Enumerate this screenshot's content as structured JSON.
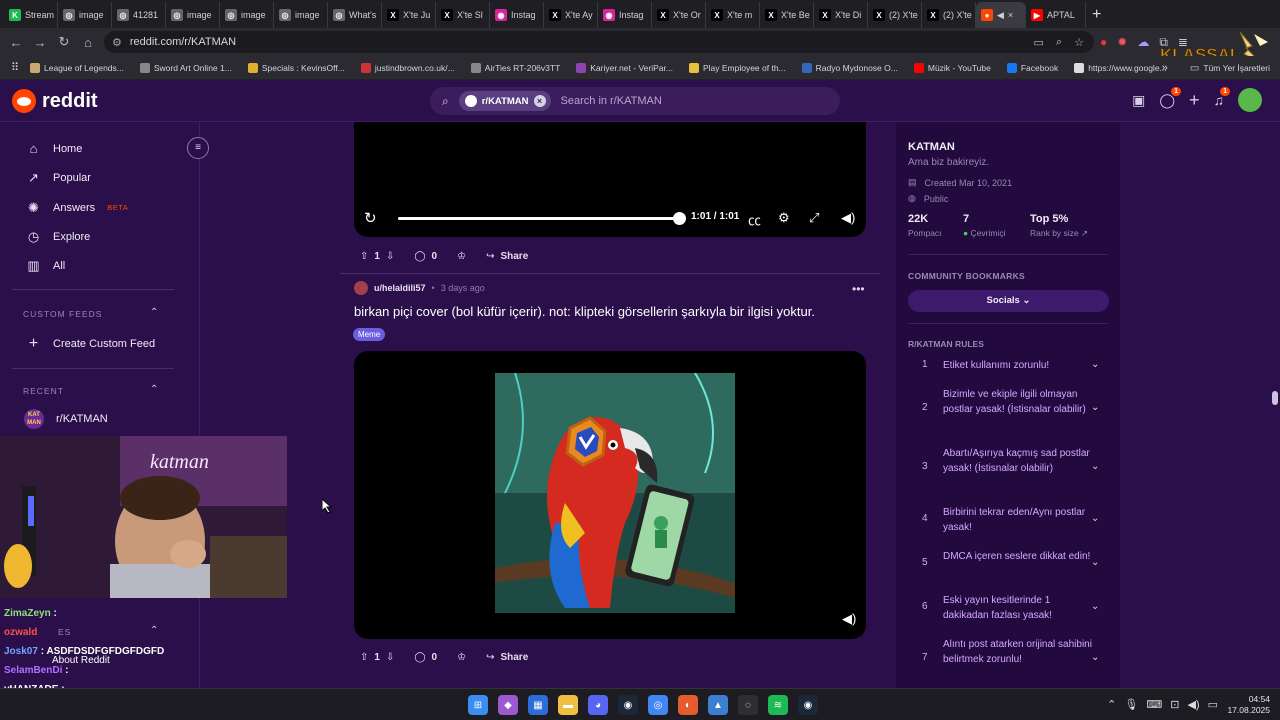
{
  "browser": {
    "tabs": [
      {
        "label": "Stream",
        "color": "#1db954",
        "glyph": "K"
      },
      {
        "label": "image",
        "color": "#666",
        "glyph": "◎"
      },
      {
        "label": "41281",
        "color": "#666",
        "glyph": "◎"
      },
      {
        "label": "image",
        "color": "#666",
        "glyph": "◎"
      },
      {
        "label": "image",
        "color": "#666",
        "glyph": "◎"
      },
      {
        "label": "image",
        "color": "#666",
        "glyph": "◎"
      },
      {
        "label": "What's",
        "color": "#666",
        "glyph": "◎"
      },
      {
        "label": "X'te Ju",
        "color": "#000",
        "glyph": "X"
      },
      {
        "label": "X'te Sl",
        "color": "#000",
        "glyph": "X"
      },
      {
        "label": "Instag",
        "color": "#d6249f",
        "glyph": "◉"
      },
      {
        "label": "X'te Ay",
        "color": "#000",
        "glyph": "X"
      },
      {
        "label": "Instag",
        "color": "#d6249f",
        "glyph": "◉"
      },
      {
        "label": "X'te Or",
        "color": "#000",
        "glyph": "X"
      },
      {
        "label": "X'te m",
        "color": "#000",
        "glyph": "X"
      },
      {
        "label": "X'te Be",
        "color": "#000",
        "glyph": "X"
      },
      {
        "label": "X'te Di",
        "color": "#000",
        "glyph": "X"
      },
      {
        "label": "(2) X'te",
        "color": "#000",
        "glyph": "X"
      },
      {
        "label": "(2) X'te",
        "color": "#000",
        "glyph": "X"
      }
    ],
    "active_tab_glyph": "●",
    "last_tab": {
      "label": "APTAL",
      "color": "#ff0000"
    },
    "url": "reddit.com/r/KATMAN",
    "bookmarks": [
      {
        "label": "League of Legends...",
        "color": "#c8aa6e"
      },
      {
        "label": "Sword Art Online 1...",
        "color": "#888"
      },
      {
        "label": "Specials : KevinsOff...",
        "color": "#e0b030"
      },
      {
        "label": "justindbrown.co.uk/...",
        "color": "#c33"
      },
      {
        "label": "AirTies RT-206v3TT",
        "color": "#888"
      },
      {
        "label": "Kariyer.net - VeriPar...",
        "color": "#8e44ad"
      },
      {
        "label": "Play Employee of th...",
        "color": "#e8c040"
      },
      {
        "label": "Radyo Mydonose O...",
        "color": "#3466c0"
      },
      {
        "label": "Müzik - YouTube",
        "color": "#ff0000"
      },
      {
        "label": "Facebook",
        "color": "#1877f2"
      },
      {
        "label": "https://www.google...",
        "color": "#ddd"
      }
    ],
    "bookmarks_folder": "Tüm Yer İşaretleri"
  },
  "header": {
    "logo": "reddit",
    "search_chip": "r/KATMAN",
    "search_placeholder": "Search in r/KATMAN",
    "chat_badge": "1",
    "notif_badge": "1"
  },
  "sidebar": {
    "items": [
      {
        "label": "Home",
        "icon": "⌂"
      },
      {
        "label": "Popular",
        "icon": "↗"
      },
      {
        "label": "Answers",
        "icon": "✺",
        "tag": "BETA"
      },
      {
        "label": "Explore",
        "icon": "◷"
      },
      {
        "label": "All",
        "icon": "▥"
      }
    ],
    "custom_feeds_title": "CUSTOM FEEDS",
    "create_custom_feed": "Create Custom Feed",
    "recent_title": "RECENT",
    "recent_item": "r/KATMAN",
    "recent_icon_text": "KAT MAN",
    "resources_title": "ES",
    "about": "About Reddit"
  },
  "chat": [
    {
      "user": "ZimaZeyn",
      "msg": ":",
      "color": "#8ee07a"
    },
    {
      "user": "ozwald",
      "msg": "",
      "color": "#ff5050"
    },
    {
      "user": "Josk07",
      "msg": ": ASDFDSDFGFDGFDGFD",
      "color": "#6fa8ff"
    },
    {
      "user": "SelamBenDi",
      "msg": ":",
      "color": "#b070ff"
    },
    {
      "user": "vHANZADE",
      "msg": ":",
      "color": "#ffffff"
    }
  ],
  "feed": {
    "video1": {
      "time": "1:01 / 1:01",
      "progress": 1.0
    },
    "post1_actions": {
      "votes": "1",
      "comments": "0",
      "share": "Share"
    },
    "post2": {
      "user": "u/helaldili57",
      "time": "3 days ago",
      "title": "birkan piçi cover (bol küfür içerir). not: klipteki görsellerin şarkıyla bir ilgisi yoktur.",
      "flair": "Meme",
      "votes": "1",
      "comments": "0",
      "share": "Share"
    }
  },
  "community": {
    "name": "KATMAN",
    "description": "Ama biz bakireyiz.",
    "created": "Created Mar 10, 2021",
    "visibility": "Public",
    "members": "22K",
    "members_label": "Pompacı",
    "online": "7",
    "online_label": "Çevrimiçi",
    "rank": "Top 5%",
    "rank_label": "Rank by size",
    "bookmarks_title": "COMMUNITY BOOKMARKS",
    "socials": "Socials",
    "rules_title": "R/KATMAN RULES",
    "rules": [
      {
        "n": "1",
        "text": "Etiket kullanımı zorunlu!"
      },
      {
        "n": "2",
        "text": "Bizimle ve ekiple ilgili olmayan postlar yasak! (İstisnalar olabilir)"
      },
      {
        "n": "3",
        "text": "Abartı/Aşırıya kaçmış sad postlar yasak! (İstisnalar olabilir)"
      },
      {
        "n": "4",
        "text": "Birbirini tekrar eden/Aynı postlar yasak!"
      },
      {
        "n": "5",
        "text": "DMCA içeren seslere dikkat edin!"
      },
      {
        "n": "6",
        "text": "Eski yayın kesitlerinde 1 dakikadan fazlası yasak!"
      },
      {
        "n": "7",
        "text": "Alıntı post atarken orijinal sahibini belirtmek zorunlu!"
      }
    ]
  },
  "taskbar": {
    "time": "04:54",
    "date": "17.08.2025",
    "apps": [
      {
        "name": "start-icon",
        "color": "#3b8ef0",
        "glyph": "⊞"
      },
      {
        "name": "copilot-icon",
        "color": "#9b59d0",
        "glyph": "◆"
      },
      {
        "name": "files-icon",
        "color": "#2c6ed8",
        "glyph": "▦"
      },
      {
        "name": "explorer-icon",
        "color": "#f0c040",
        "glyph": "▬"
      },
      {
        "name": "discord-icon",
        "color": "#5865f2",
        "glyph": "◕"
      },
      {
        "name": "steam-icon",
        "color": "#1b2838",
        "glyph": "◉"
      },
      {
        "name": "chrome-icon",
        "color": "#4285f4",
        "glyph": "◎"
      },
      {
        "name": "firefox-icon",
        "color": "#e55b2d",
        "glyph": "◐"
      },
      {
        "name": "photos-icon",
        "color": "#3b7fd0",
        "glyph": "▲"
      },
      {
        "name": "obs-icon",
        "color": "#302e31",
        "glyph": "◌"
      },
      {
        "name": "spotify-icon",
        "color": "#1db954",
        "glyph": "≋"
      },
      {
        "name": "steam2-icon",
        "color": "#1b2838",
        "glyph": "◉"
      }
    ]
  }
}
